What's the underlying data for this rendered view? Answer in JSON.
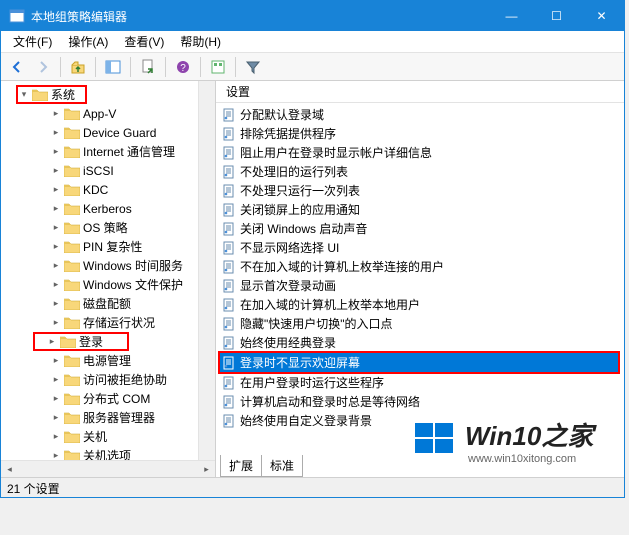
{
  "window": {
    "title": "本地组策略编辑器"
  },
  "controls": {
    "minimize": "—",
    "maximize": "☐",
    "close": "✕"
  },
  "menu": {
    "file": "文件(F)",
    "action": "操作(A)",
    "view": "查看(V)",
    "help": "帮助(H)"
  },
  "tree": {
    "root": "系统",
    "items": [
      "App-V",
      "Device Guard",
      "Internet 通信管理",
      "iSCSI",
      "KDC",
      "Kerberos",
      "OS 策略",
      "PIN 复杂性",
      "Windows 时间服务",
      "Windows 文件保护",
      "磁盘配额",
      "存储运行状况",
      "登录",
      "电源管理",
      "访问被拒绝协助",
      "分布式 COM",
      "服务器管理器",
      "关机",
      "关机选项"
    ],
    "highlighted_index": 12
  },
  "column_header": "设置",
  "settings": {
    "items": [
      "分配默认登录域",
      "排除凭据提供程序",
      "阻止用户在登录时显示帐户详细信息",
      "不处理旧的运行列表",
      "不处理只运行一次列表",
      "关闭锁屏上的应用通知",
      "关闭 Windows 启动声音",
      "不显示网络选择 UI",
      "不在加入域的计算机上枚举连接的用户",
      "显示首次登录动画",
      "在加入域的计算机上枚举本地用户",
      "隐藏\"快速用户切换\"的入口点",
      "始终使用经典登录",
      "登录时不显示欢迎屏幕",
      "在用户登录时运行这些程序",
      "计算机启动和登录时总是等待网络",
      "始终使用自定义登录背景"
    ],
    "selected_index": 13
  },
  "tabs": {
    "left": "扩展",
    "right": "标准"
  },
  "status": "21 个设置",
  "watermark_url": "www.win10xitong.com",
  "watermark_brand": "Win10之家"
}
